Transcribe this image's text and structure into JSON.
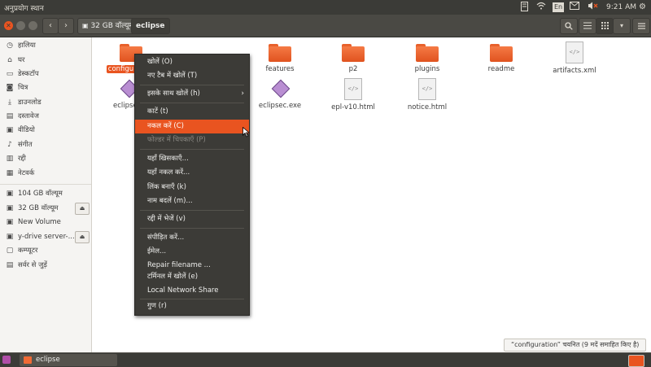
{
  "top_panel": {
    "app_menu": "अनुप्रयोग  स्थान",
    "keyboard": "En",
    "time": "9:21 AM"
  },
  "colors": {
    "accent": "#e95420",
    "panel": "#3b3b37",
    "folder": "#f06a35"
  },
  "nav": {
    "back_icon": "chevron-left-icon",
    "forward_icon": "chevron-right-icon"
  },
  "breadcrumb": {
    "volume": "32 GB वॉल्यूम",
    "current": "eclipse"
  },
  "toolbar": {
    "search_icon": "search-icon",
    "list_icon": "list-view-icon",
    "grid_icon": "grid-view-icon",
    "menu_icon": "menu-icon"
  },
  "sidebar": {
    "items": [
      {
        "label": "हालिया",
        "icon": "clock-icon"
      },
      {
        "label": "घर",
        "icon": "home-icon"
      },
      {
        "label": "डेस्कटॉप",
        "icon": "folder-icon"
      },
      {
        "label": "चित्र",
        "icon": "camera-icon"
      },
      {
        "label": "डाउनलोड",
        "icon": "download-icon"
      },
      {
        "label": "दस्तावेज",
        "icon": "document-icon"
      },
      {
        "label": "वीडियो",
        "icon": "video-icon"
      },
      {
        "label": "संगीत",
        "icon": "music-icon"
      },
      {
        "label": "रद्दी",
        "icon": "trash-icon"
      },
      {
        "label": "नेटवर्क",
        "icon": "network-icon"
      },
      {
        "label": "104 GB वॉल्यूम",
        "icon": "drive-icon"
      },
      {
        "label": "32 GB वॉल्यूम",
        "icon": "drive-icon"
      },
      {
        "label": "New Volume",
        "icon": "drive-icon"
      },
      {
        "label": "y-drive server-...",
        "icon": "drive-icon"
      },
      {
        "label": "कम्प्यूटर",
        "icon": "computer-icon"
      },
      {
        "label": "सर्वर से जुड़ें",
        "icon": "server-icon"
      }
    ]
  },
  "files": [
    {
      "name": "configuration",
      "type": "folder"
    },
    {
      "name": "features",
      "type": "folder"
    },
    {
      "name": "p2",
      "type": "folder"
    },
    {
      "name": "plugins",
      "type": "folder"
    },
    {
      "name": "readme",
      "type": "folder"
    },
    {
      "name": "artifacts.xml",
      "type": "xml"
    },
    {
      "name": "eclipse",
      "type": "exe"
    },
    {
      "name": "eclipsec.exe",
      "type": "exe"
    },
    {
      "name": "epl-v10.html",
      "type": "html"
    },
    {
      "name": "notice.html",
      "type": "html"
    }
  ],
  "context_menu": {
    "items": [
      {
        "label": "खोलें (O)"
      },
      {
        "label": "नए टैब में खोलें (T)"
      },
      {
        "label": "इसके साथ खोलें (h)",
        "submenu": true
      },
      {
        "label": "काटें (t)"
      },
      {
        "label": "नकल करें (C)",
        "highlighted": true
      },
      {
        "label": "फोल्डर में चिपकाएँ (P)",
        "disabled": true
      },
      {
        "label": "यहाँ खिसकाएँ..."
      },
      {
        "label": "यहाँ नकल करें..."
      },
      {
        "label": "लिंक बनाएँ (k)"
      },
      {
        "label": "नाम बदलें (m)..."
      },
      {
        "label": "रद्दी में भेजें (v)"
      },
      {
        "label": "संपीड़ित करें..."
      },
      {
        "label": "ईमेल..."
      },
      {
        "label": "Repair filename ..."
      },
      {
        "label": "टर्मिनल में खोलें (e)"
      },
      {
        "label": "Local Network Share"
      },
      {
        "label": "गुण (r)"
      }
    ]
  },
  "status": {
    "text": "“configuration” चयनित (9 मदें समाहित किए है)"
  },
  "taskbar": {
    "window_label": "eclipse"
  }
}
